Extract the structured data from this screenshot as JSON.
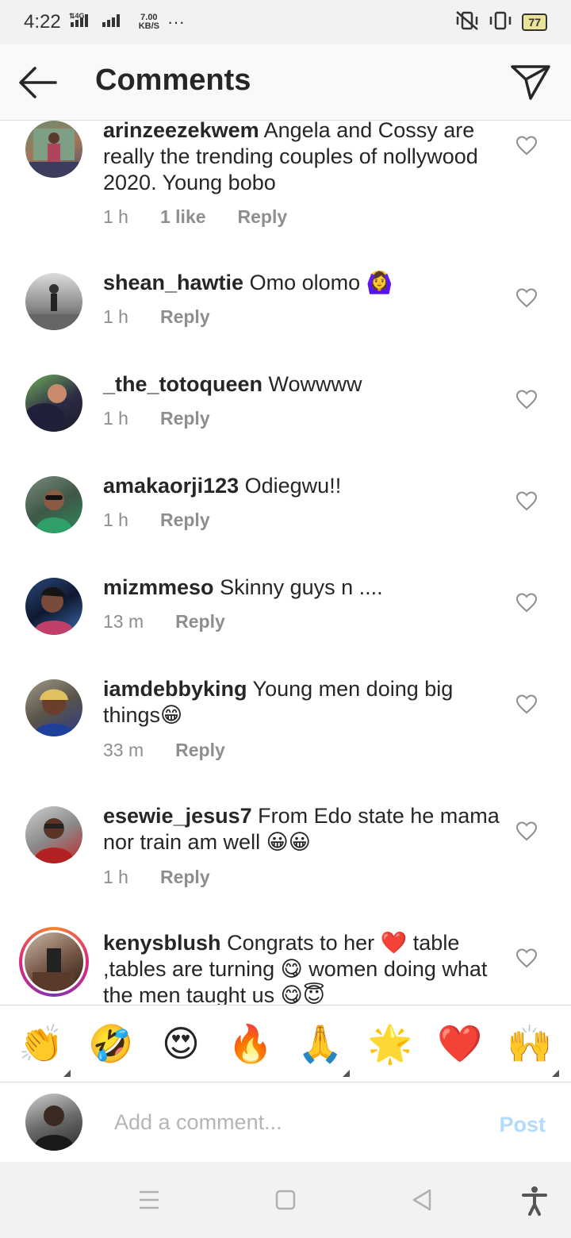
{
  "status": {
    "time": "4:22",
    "network_type": "4G",
    "speed_value": "7.00",
    "speed_unit": "KB/S",
    "more": "···",
    "battery": "77"
  },
  "header": {
    "title": "Comments",
    "back_icon": "arrow-left-icon",
    "send_icon": "paper-plane-icon"
  },
  "comments": [
    {
      "user": "arinzeezekwem",
      "text": " Angela and Cossy are really the trending couples of nollywood 2020.  Young bobo",
      "time": "1 h",
      "likes": "1 like",
      "reply": "Reply"
    },
    {
      "user": "shean_hawtie",
      "text": " Omo olomo 🙆‍♀️",
      "time": "1 h",
      "reply": "Reply"
    },
    {
      "user": "_the_totoqueen",
      "text": " Wowwww",
      "time": "1 h",
      "reply": "Reply"
    },
    {
      "user": "amakaorji123",
      "text": " Odiegwu!!",
      "time": "1 h",
      "reply": "Reply"
    },
    {
      "user": "mizmmeso",
      "text": " Skinny guys n ....",
      "time": "13 m",
      "reply": "Reply"
    },
    {
      "user": "iamdebbyking",
      "text": " Young men doing big things😁",
      "time": "33 m",
      "reply": "Reply"
    },
    {
      "user": "esewie_jesus7",
      "text": " From Edo state he mama nor train am well 😀😀",
      "time": "1 h",
      "reply": "Reply"
    },
    {
      "user": "kenysblush",
      "text": " Congrats to her ❤️ table ,tables are turning 😋 women doing what the men taught us 😋😇",
      "time": "",
      "reply": ""
    }
  ],
  "emoji_bar": [
    "👏",
    "🤣",
    "😍",
    "🔥",
    "🙏",
    "🌟",
    "❤️",
    "🙌"
  ],
  "compose": {
    "placeholder": "Add a comment...",
    "post_label": "Post"
  },
  "nav": {
    "icons": [
      "menu-icon",
      "home-square-icon",
      "back-triangle-icon",
      "accessibility-icon"
    ]
  }
}
